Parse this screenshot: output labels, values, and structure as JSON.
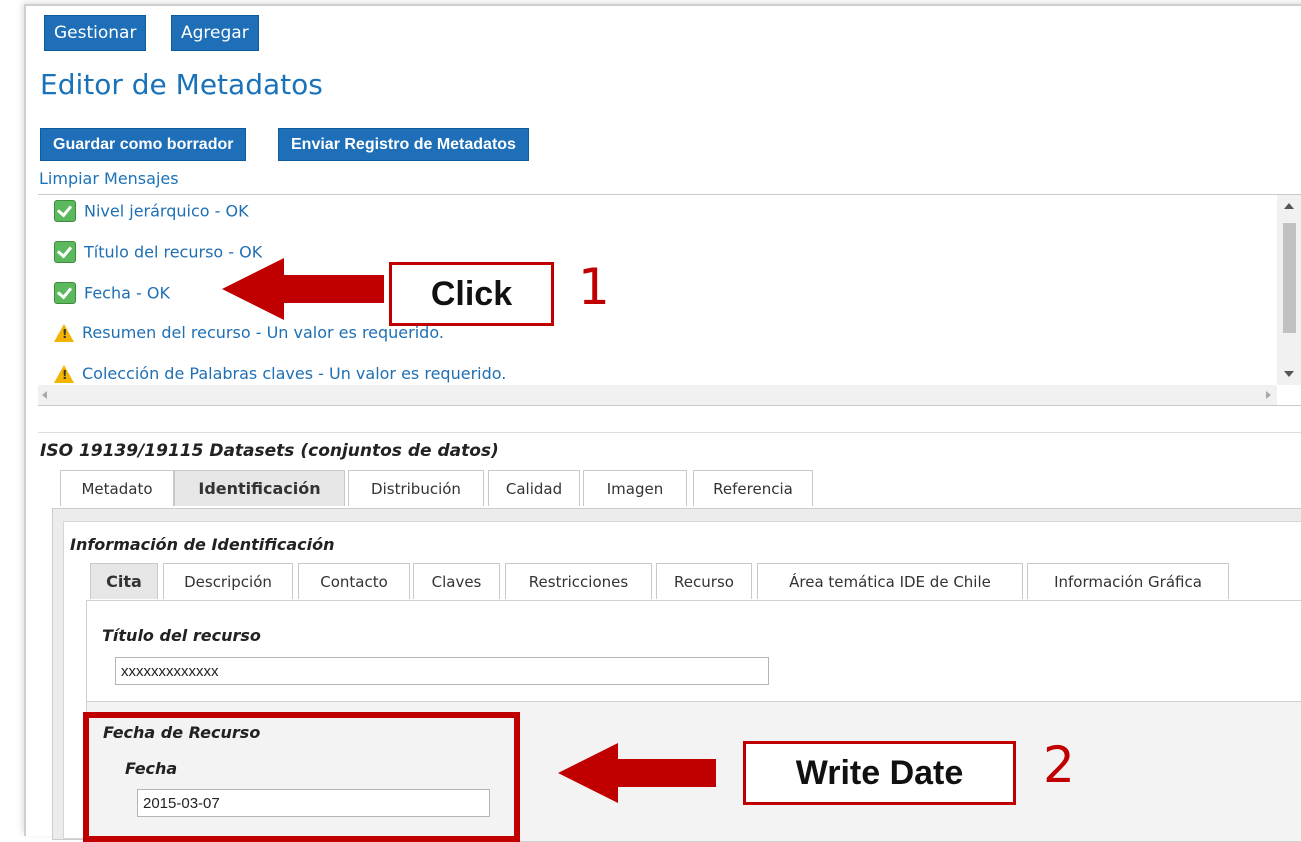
{
  "nav": {
    "manage_label": "Gestionar",
    "add_label": "Agregar"
  },
  "page": {
    "title": "Editor de Metadatos"
  },
  "actions": {
    "save_draft_label": "Guardar como borrador",
    "send_label": "Enviar Registro de Metadatos",
    "clear_messages_label": "Limpiar Mensajes"
  },
  "messages": [
    {
      "icon": "check-icon",
      "text": "Nivel jerárquico - OK"
    },
    {
      "icon": "check-icon",
      "text": "Título del recurso - OK"
    },
    {
      "icon": "check-icon",
      "text": "Fecha - OK"
    },
    {
      "icon": "warning-icon",
      "text": "Resumen del recurso - Un valor es requerido."
    },
    {
      "icon": "warning-icon",
      "text": "Colección de Palabras claves - Un valor es requerido."
    }
  ],
  "form": {
    "title": "ISO 19139/19115 Datasets (conjuntos de datos)",
    "tabs": [
      {
        "label": "Metadato",
        "active": false
      },
      {
        "label": "Identificación",
        "active": true
      },
      {
        "label": "Distribución",
        "active": false
      },
      {
        "label": "Calidad",
        "active": false
      },
      {
        "label": "Imagen",
        "active": false
      },
      {
        "label": "Referencia",
        "active": false
      }
    ],
    "section_title": "Información de Identificación",
    "subtabs": [
      {
        "label": "Cita",
        "active": true
      },
      {
        "label": "Descripción",
        "active": false
      },
      {
        "label": "Contacto",
        "active": false
      },
      {
        "label": "Claves",
        "active": false
      },
      {
        "label": "Restricciones",
        "active": false
      },
      {
        "label": "Recurso",
        "active": false
      },
      {
        "label": "Área temática IDE de Chile",
        "active": false
      },
      {
        "label": "Información Gráfica",
        "active": false
      }
    ],
    "resource_title_label": "Título del recurso",
    "resource_title_value": "xxxxxxxxxxxxx",
    "resource_date_label": "Fecha de Recurso",
    "date_label": "Fecha",
    "date_value": "2015-03-07"
  },
  "annotations": {
    "click_label": "Click",
    "step1": "1",
    "write_label": "Write Date",
    "step2": "2",
    "color": "#c00000"
  }
}
